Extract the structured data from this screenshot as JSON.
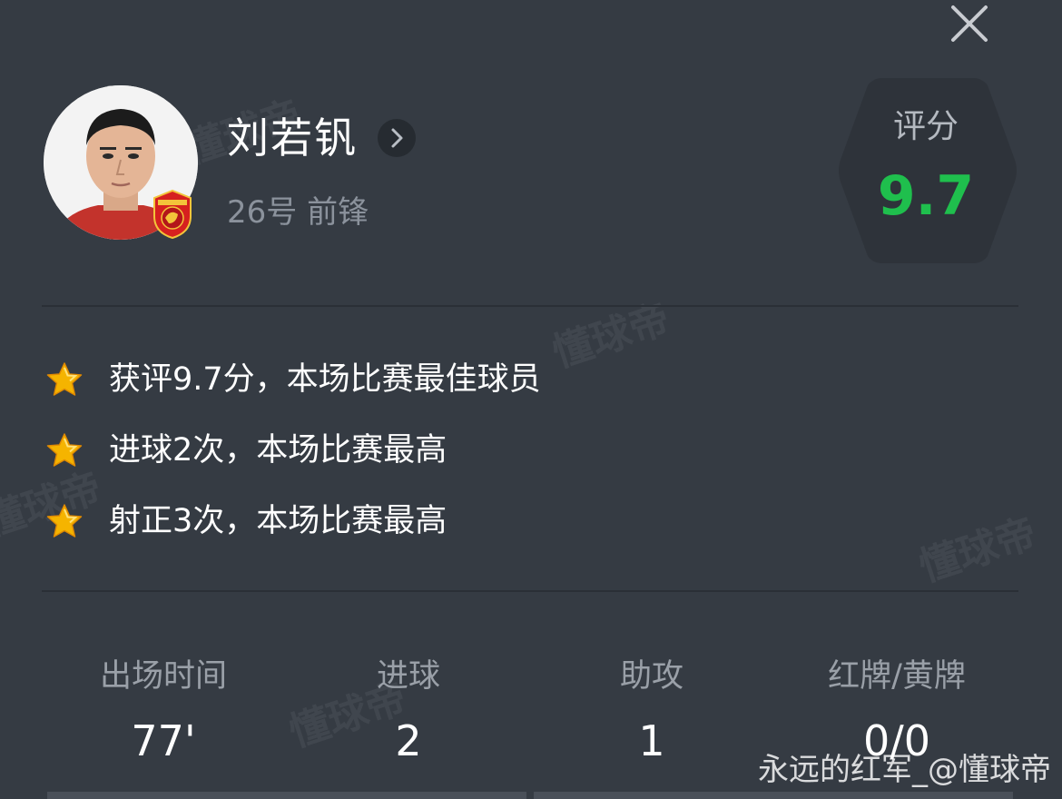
{
  "player": {
    "name": "刘若钒",
    "meta": "26号 前锋"
  },
  "rating": {
    "label": "评分",
    "value": "9.7",
    "color": "#1fbf4d"
  },
  "highlights": [
    {
      "icon": "star-icon",
      "text": "获评9.7分，本场比赛最佳球员"
    },
    {
      "icon": "star-icon",
      "text": "进球2次，本场比赛最高"
    },
    {
      "icon": "star-icon",
      "text": "射正3次，本场比赛最高"
    }
  ],
  "stats": [
    {
      "label": "出场时间",
      "value": "77'"
    },
    {
      "label": "进球",
      "value": "2"
    },
    {
      "label": "助攻",
      "value": "1"
    },
    {
      "label": "红牌/黄牌",
      "value": "0/0"
    }
  ],
  "watermark": "懂球帝",
  "source_tag": "永远的红军_@懂球帝",
  "colors": {
    "background": "#353b43",
    "accent_green": "#1fbf4d",
    "star_gold": "#f5b400"
  }
}
